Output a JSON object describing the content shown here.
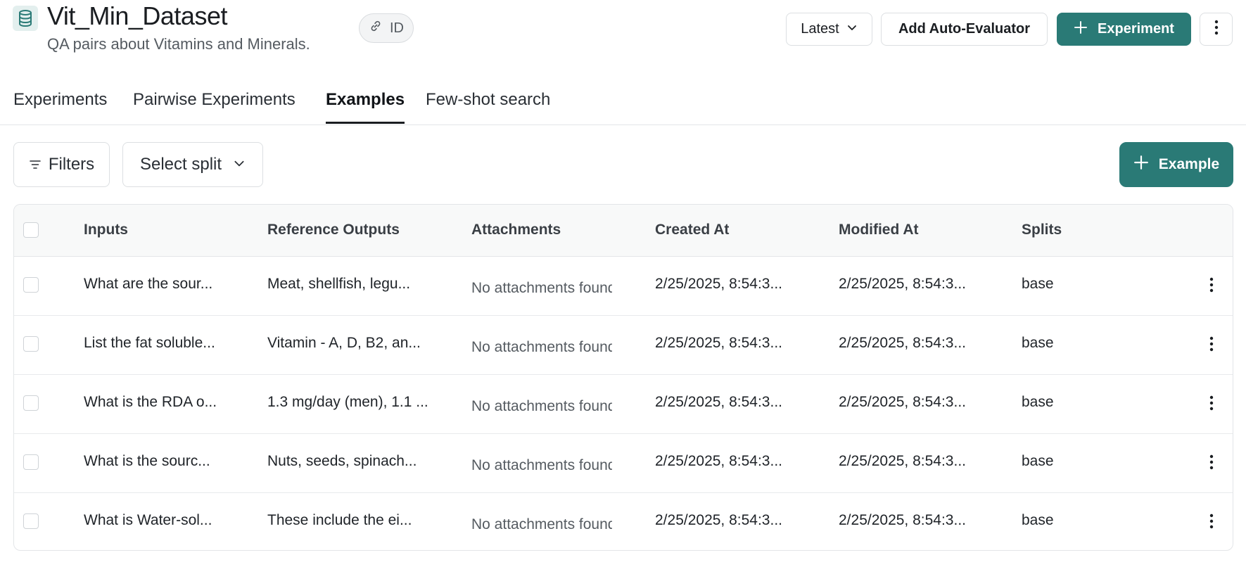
{
  "header": {
    "title": "Vit_Min_Dataset",
    "subtitle": "QA pairs about Vitamins and Minerals.",
    "id_label": "ID",
    "version_select": "Latest",
    "auto_evaluator_label": "Add Auto-Evaluator",
    "experiment_label": "Experiment"
  },
  "tabs": [
    {
      "label": "Experiments",
      "active": false
    },
    {
      "label": "Pairwise Experiments",
      "active": false
    },
    {
      "label": "Examples",
      "active": true
    },
    {
      "label": "Few-shot search",
      "active": false
    }
  ],
  "toolbar": {
    "filters_label": "Filters",
    "split_placeholder": "Select split",
    "add_example_label": "Example"
  },
  "table": {
    "columns": [
      "Inputs",
      "Reference Outputs",
      "Attachments",
      "Created At",
      "Modified At",
      "Splits"
    ],
    "rows": [
      {
        "inputs": "What are the sour...",
        "outputs": "Meat, shellfish, legu...",
        "attachments": "No attachments found",
        "created": "2/25/2025, 8:54:3...",
        "modified": "2/25/2025, 8:54:3...",
        "split": "base"
      },
      {
        "inputs": "List the fat soluble...",
        "outputs": "Vitamin - A, D, B2, an...",
        "attachments": "No attachments found",
        "created": "2/25/2025, 8:54:3...",
        "modified": "2/25/2025, 8:54:3...",
        "split": "base"
      },
      {
        "inputs": "What is the RDA o...",
        "outputs": "1.3 mg/day (men), 1.1 ...",
        "attachments": "No attachments found",
        "created": "2/25/2025, 8:54:3...",
        "modified": "2/25/2025, 8:54:3...",
        "split": "base"
      },
      {
        "inputs": "What is the sourc...",
        "outputs": "Nuts, seeds, spinach...",
        "attachments": "No attachments found",
        "created": "2/25/2025, 8:54:3...",
        "modified": "2/25/2025, 8:54:3...",
        "split": "base"
      },
      {
        "inputs": "What is Water-sol...",
        "outputs": "These include the ei...",
        "attachments": "No attachments found",
        "created": "2/25/2025, 8:54:3...",
        "modified": "2/25/2025, 8:54:3...",
        "split": "base"
      }
    ]
  },
  "colors": {
    "accent": "#2a7a76",
    "icon_bg": "#e3efee"
  },
  "icons": [
    "database-icon",
    "link-icon",
    "chevron-down-icon",
    "plus-icon",
    "kebab-menu-icon",
    "filter-icon"
  ]
}
